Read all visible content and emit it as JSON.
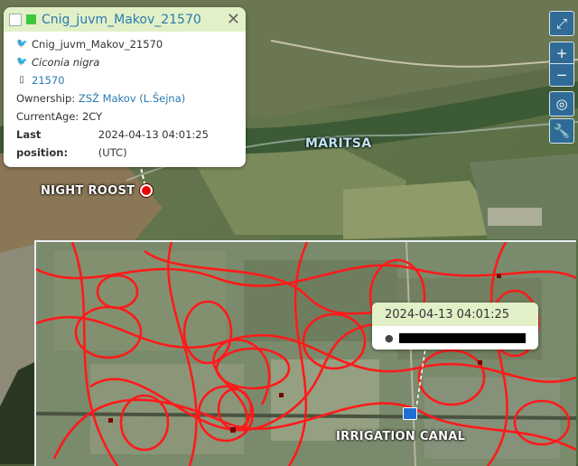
{
  "popup": {
    "title": "Cnig_juvm_Makov_21570",
    "name_line": "Cnig_juvm_Makov_21570",
    "species": "Ciconia nigra",
    "tag_id": "21570",
    "ownership_label": "Ownership:",
    "ownership_value": "ZSŽ Makov (L.Šejna)",
    "age_label": "CurrentAge:",
    "age_value": "2CY",
    "lastpos_label": "Last position:",
    "lastpos_value": "2024-04-13 04:01:25 (UTC)",
    "close_icon": "close-icon",
    "marker_color": "#3cc83c"
  },
  "map_labels": {
    "night_roost": "NIGHT ROOST",
    "river": "MARITSA",
    "irrigation": "IRRIGATION CANAL"
  },
  "tooltip": {
    "timestamp": "2024-04-13 04:01:25",
    "location_icon": "location-pin-icon"
  },
  "controls": {
    "fullscreen_icon": "expand-icon",
    "zoom_in": "+",
    "zoom_out": "−",
    "locate_icon": "target-icon",
    "tools_icon": "wrench-icon"
  },
  "colors": {
    "track": "#ff1a1a",
    "popup_header": "#e2f0c8",
    "control_bg": "#2f6b96",
    "link": "#2a7ab0"
  }
}
